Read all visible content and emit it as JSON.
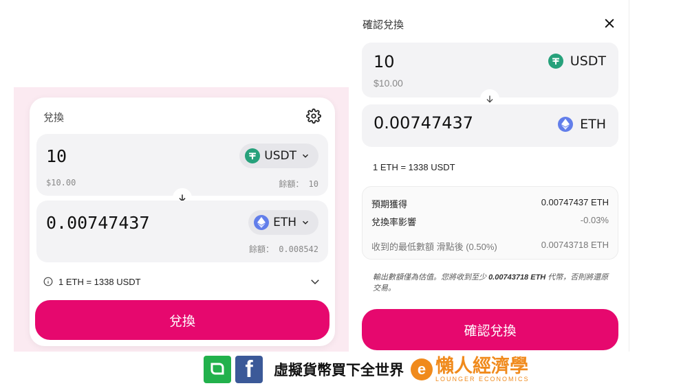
{
  "swap": {
    "title": "兌換",
    "from": {
      "amount": "10",
      "usd": "$10.00",
      "token": "USDT",
      "balance": "餘額： 10"
    },
    "to": {
      "amount": "0.00747437",
      "token": "ETH",
      "balance": "餘額： 0.008542"
    },
    "rate": "1 ETH = 1338 USDT",
    "button": "兌換",
    "icons": [
      "gear-icon",
      "usdt-icon",
      "eth-icon",
      "chevron-down-icon",
      "arrow-down-icon",
      "info-icon"
    ]
  },
  "confirm": {
    "title": "確認兌換",
    "from": {
      "amount": "10",
      "usd": "$10.00",
      "token": "USDT"
    },
    "to": {
      "amount": "0.00747437",
      "token": "ETH"
    },
    "rate": "1 ETH = 1338 USDT",
    "details": [
      {
        "label": "預期獲得",
        "value": "0.00747437 ETH"
      },
      {
        "label": "兌換率影響",
        "value": "-0.03%"
      },
      {
        "label": "收到的最低數額 滑點後 (0.50%)",
        "value": "0.00743718 ETH"
      }
    ],
    "note_prefix": "輸出數額僅為估值。您將收到至少",
    "note_amount": "0.00743718 ETH",
    "note_suffix": "代幣，否則將還原交易。",
    "button": "確認兌換"
  },
  "footer": {
    "slogan": "虛擬貨幣買下全世界",
    "logo_cn": "懶人經濟學",
    "logo_en": "LOUNGER ECONOMICS",
    "logo_letter": "e",
    "fb_letter": "f"
  },
  "colors": {
    "accent": "#e6086e",
    "usdt": "#26a17b",
    "eth": "#627eea",
    "brand_orange": "#f08a1c"
  }
}
